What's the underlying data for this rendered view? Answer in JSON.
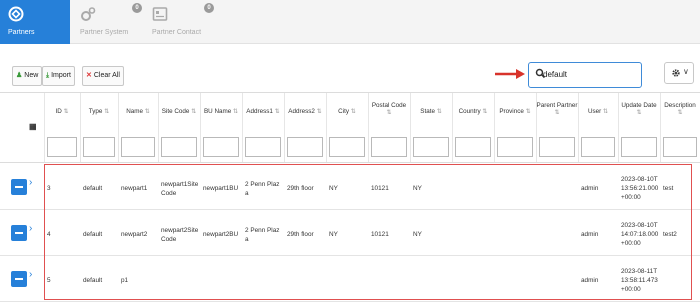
{
  "modules": [
    {
      "label": "Partners",
      "badge": ""
    },
    {
      "label": "Partner System",
      "badge": "0"
    },
    {
      "label": "Partner Contact",
      "badge": "0"
    }
  ],
  "toolbar": {
    "new_label": "New",
    "import_label": "Import",
    "clear_all_label": "Clear All",
    "search_value": "default",
    "settings_caret": "∨"
  },
  "grid": {
    "columns": [
      "ID",
      "Type",
      "Name",
      "Site Code",
      "BU Name",
      "Address1",
      "Address2",
      "City",
      "Postal Code",
      "State",
      "Country",
      "Province",
      "Parent Partner",
      "User",
      "Update Date",
      "Description"
    ],
    "sort_glyph": "⇅",
    "rows": [
      {
        "id": "3",
        "type": "default",
        "name": "newpart1",
        "site_code": "newpart1SiteCode",
        "bu_name": "newpart1BU",
        "address1": "2 Penn Plaza",
        "address2": "29th floor",
        "city": "NY",
        "postal_code": "10121",
        "state": "NY",
        "country": "",
        "province": "",
        "parent_partner": "",
        "user": "admin",
        "update_date": "2023-08-10T13:56:21.000+00:00",
        "description": "test"
      },
      {
        "id": "4",
        "type": "default",
        "name": "newpart2",
        "site_code": "newpart2SiteCode",
        "bu_name": "newpart2BU",
        "address1": "2 Penn Plaza",
        "address2": "29th floor",
        "city": "NY",
        "postal_code": "10121",
        "state": "NY",
        "country": "",
        "province": "",
        "parent_partner": "",
        "user": "admin",
        "update_date": "2023-08-10T14:07:18.000+00:00",
        "description": "test2"
      },
      {
        "id": "5",
        "type": "default",
        "name": "p1",
        "site_code": "",
        "bu_name": "",
        "address1": "",
        "address2": "",
        "city": "",
        "postal_code": "",
        "state": "",
        "country": "",
        "province": "",
        "parent_partner": "",
        "user": "admin",
        "update_date": "2023-08-11T13:58:11.473+00:00",
        "description": ""
      }
    ]
  },
  "colors": {
    "accent": "#2680d9",
    "highlight": "#e05050"
  }
}
